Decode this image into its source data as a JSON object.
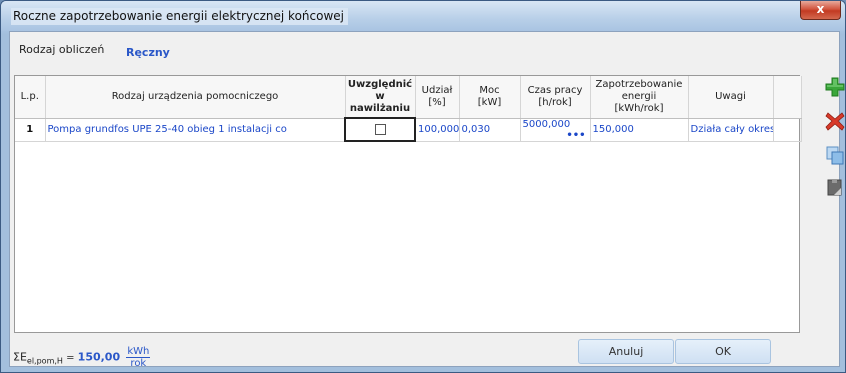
{
  "window": {
    "title": "Roczne zapotrzebowanie energii elektrycznej końcowej",
    "close_label": "x"
  },
  "calc": {
    "label": "Rodzaj obliczeń",
    "value": "Ręczny"
  },
  "table": {
    "headers": {
      "lp": "L.p.",
      "device": "Rodzaj urządzenia pomocniczego",
      "include_l1": "Uwzględnić w",
      "include_l2": "nawilżaniu",
      "share_l1": "Udział",
      "share_l2": "[%]",
      "power_l1": "Moc",
      "power_l2": "[kW]",
      "time_l1": "Czas pracy",
      "time_l2": "[h/rok]",
      "demand_l1": "Zapotrzebowanie",
      "demand_l2": "energii",
      "demand_l3": "[kWh/rok]",
      "notes": "Uwagi"
    },
    "rows": [
      {
        "lp": "1",
        "device": "Pompa grundfos UPE 25-40 obieg 1 instalacji co",
        "include": false,
        "share": "100,000",
        "power": "0,030",
        "time": "5000,000",
        "time_dots": "•••",
        "demand": "150,000",
        "notes": "Działa cały okres"
      }
    ]
  },
  "toolbar": {
    "add_icon": "plus-icon",
    "delete_icon": "delete-icon",
    "copy_icon": "copy-icon",
    "paste_icon": "paste-icon"
  },
  "summary": {
    "symbol": "ΣE",
    "subscript": "el,pom,H",
    "equals": " = ",
    "value": "150,00",
    "unit_num": "kWh",
    "unit_den": "rok"
  },
  "buttons": {
    "cancel": "Anuluj",
    "ok": "OK"
  },
  "colors": {
    "accent": "#2a57c8",
    "add": "#3aa63a",
    "delete": "#d83a2a"
  }
}
